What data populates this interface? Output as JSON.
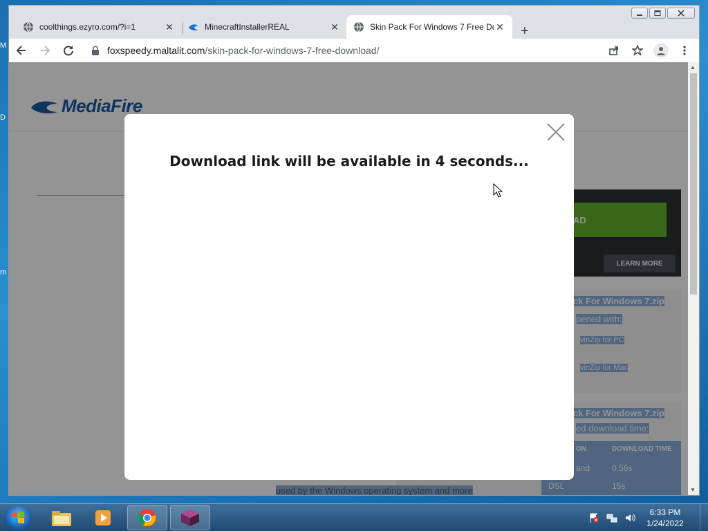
{
  "desktop": {
    "edge_labels": [
      "M",
      "D",
      "m"
    ]
  },
  "browser": {
    "tabs": [
      {
        "title": "coolthings.ezyro.com/?i=1",
        "favicon": "globe-icon",
        "active": false
      },
      {
        "title": "MinecraftInstallerREAL",
        "favicon": "mediafire-icon",
        "active": false
      },
      {
        "title": "Skin Pack For Windows 7 Free Do",
        "favicon": "globe-icon",
        "active": true
      }
    ],
    "new_tab_label": "+",
    "url_host": "foxspeedy.maltalit.com",
    "url_path": "/skin-pack-for-windows-7-free-download/"
  },
  "page": {
    "logo_text": "MediaFire",
    "download_button_fragment": "AD",
    "learn_more": "LEARN MORE",
    "file_title_1": "ck For Windows 7.zip",
    "opened_with": "pened with:",
    "winzip_pc": "vinZip for PC",
    "winzip_mac": "vinZip for Mac",
    "file_title_2": "ck For Windows 7.zip",
    "est_download": "ed download time:",
    "col_connection": "ON",
    "col_download_time": "DOWNLOAD TIME",
    "row1_conn": "and",
    "row1_time": "0.56s",
    "row2_conn": "DSL",
    "row2_time": "15s",
    "body_text": "used by the Windows operating system and more"
  },
  "modal": {
    "message": "Download link will be available in 4 seconds..."
  },
  "taskbar": {
    "items": [
      "explorer-icon",
      "media-player-icon",
      "chrome-icon",
      "minecraft-icon"
    ],
    "time": "6:33 PM",
    "date": "1/24/2022"
  },
  "colors": {
    "accent_green": "#63b42a",
    "mediafire_blue": "#1b5aa6"
  }
}
